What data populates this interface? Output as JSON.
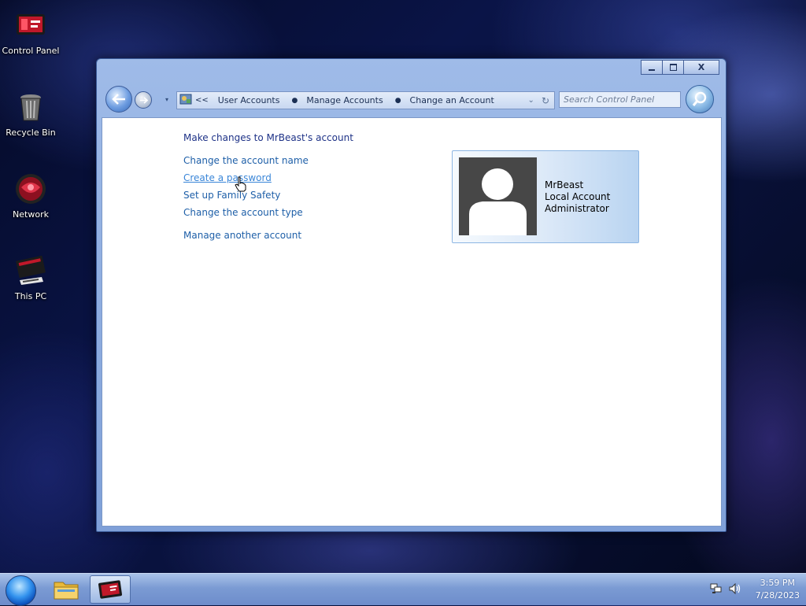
{
  "desktop": {
    "icons": [
      {
        "label": "Control Panel"
      },
      {
        "label": "Recycle Bin"
      },
      {
        "label": "Network"
      },
      {
        "label": "This PC"
      }
    ]
  },
  "window": {
    "controls": {
      "minimize": "",
      "maximize": "",
      "close": "X"
    },
    "address_bar": {
      "overflow": "<<",
      "crumbs": [
        "User Accounts",
        "Manage Accounts",
        "Change an Account"
      ]
    },
    "search": {
      "placeholder": "Search Control Panel"
    },
    "content": {
      "title": "Make changes to MrBeast's account",
      "links": [
        "Change the account name",
        "Create a password",
        "Set up Family Safety",
        "Change the account type",
        "Manage another account"
      ],
      "hovered_link": "Create a password",
      "account_card": {
        "name": "MrBeast",
        "type": "Local Account",
        "role": "Administrator"
      }
    }
  },
  "taskbar": {
    "clock": {
      "time": "3:59 PM",
      "date": "7/28/2023"
    }
  },
  "colors": {
    "link": "#1e5fa8",
    "title": "#1e3287",
    "window_frame": "#8fadE0",
    "taskbar": "#7b9bd3"
  }
}
